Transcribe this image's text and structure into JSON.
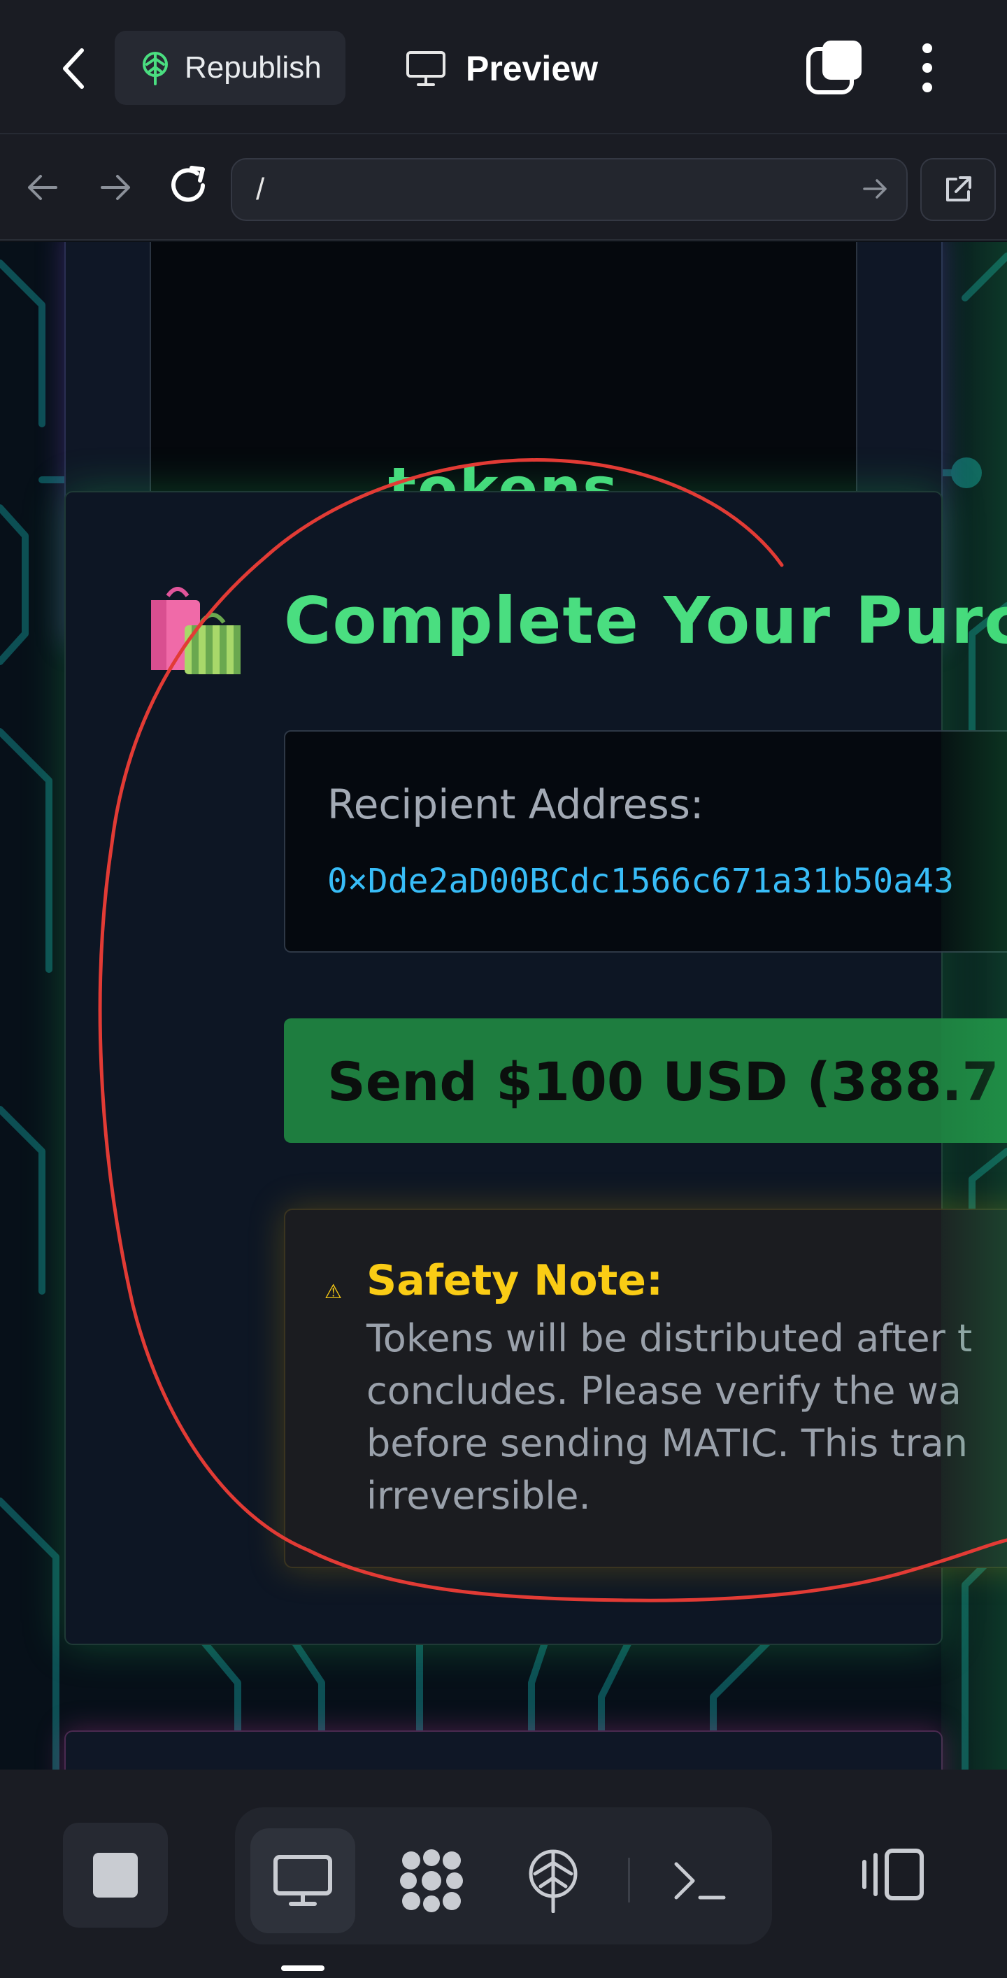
{
  "topbar": {
    "republish_label": "Republish",
    "preview_label": "Preview"
  },
  "urlbar": {
    "path": "/"
  },
  "page": {
    "top_card": {
      "partial_text": "tokens"
    },
    "purchase": {
      "title": "Complete Your Purch",
      "recipient_label": "Recipient Address:",
      "recipient_address": "0×Dde2aD00BCdc1566c671a31b50a43",
      "send_button_label": "Send $100 USD (388.7",
      "safety_title": "Safety Note:",
      "safety_lines": [
        "Tokens will be distributed after t",
        "concludes. Please verify the wa",
        "before sending MATIC. This tran",
        "irreversible."
      ]
    }
  },
  "colors": {
    "accent_green": "#4ade80",
    "address_blue": "#38bdf8",
    "warning_yellow": "#facc15",
    "annotation_red": "#e23b35"
  },
  "icons": {
    "back": "chevron-left-icon",
    "republish": "republish-icon",
    "preview": "monitor-icon",
    "tabs": "tabs-icon",
    "more": "more-vertical-icon",
    "nav_back": "arrow-left-icon",
    "nav_forward": "arrow-right-icon",
    "reload": "reload-icon",
    "go": "arrow-right-icon",
    "open_external": "external-link-icon",
    "purchase": "shopping-bags-icon",
    "warning": "warning-icon",
    "stop": "stop-icon",
    "desktop": "monitor-icon",
    "integrations": "integrations-icon",
    "deploy": "deploy-icon",
    "shell": "terminal-icon",
    "devices": "devices-icon"
  }
}
